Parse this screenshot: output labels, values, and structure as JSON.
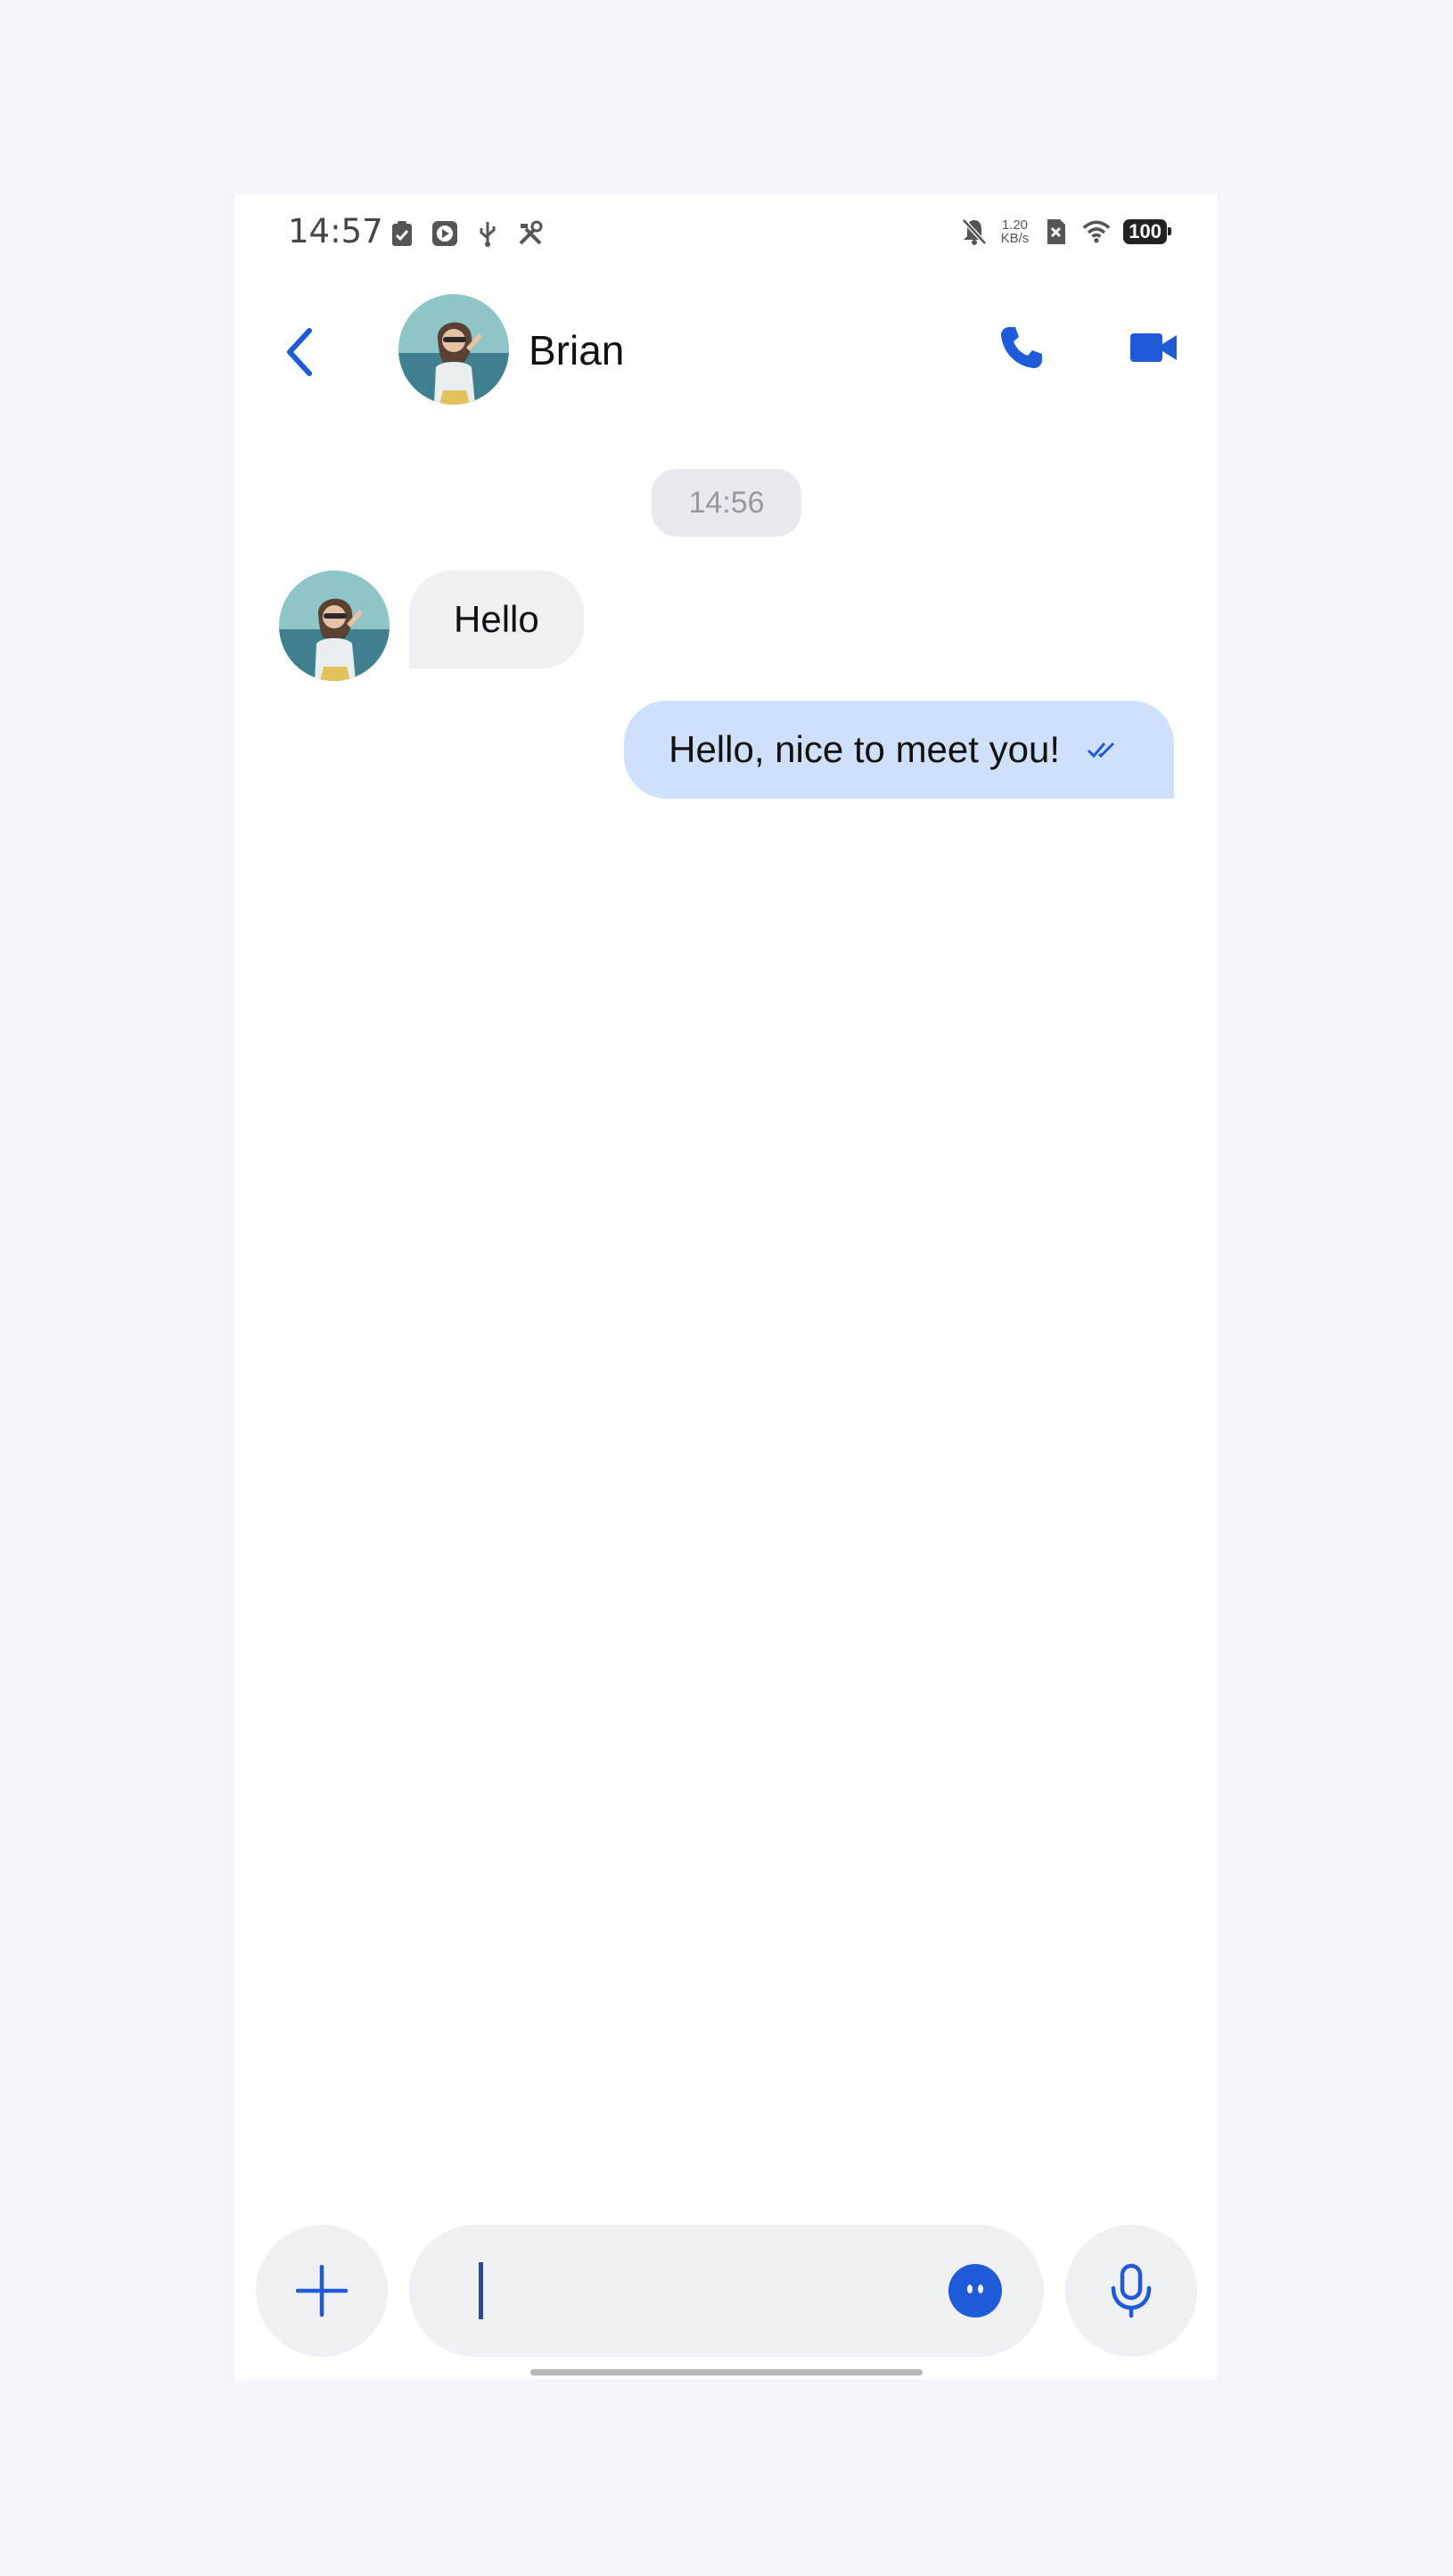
{
  "status_bar": {
    "time": "14:57",
    "net_speed_value": "1.20",
    "net_speed_unit": "KB/s",
    "battery": "100",
    "left_icons": [
      "clipboard-check-icon",
      "play-box-icon",
      "usb-icon",
      "tools-icon"
    ],
    "right_icons": [
      "bell-off-icon",
      "sim-x-icon",
      "wifi-icon"
    ]
  },
  "header": {
    "contact_name": "Brian",
    "back_icon": "chevron-left-icon",
    "call_icon": "phone-icon",
    "video_icon": "video-camera-icon"
  },
  "conversation": {
    "timestamp": "14:56",
    "messages": [
      {
        "direction": "incoming",
        "text": "Hello"
      },
      {
        "direction": "outgoing",
        "text": "Hello, nice to meet you!",
        "status": "read"
      }
    ]
  },
  "composer": {
    "value": "",
    "placeholder": "",
    "add_icon": "plus-icon",
    "emoji_icon": "emoji-icon",
    "mic_icon": "microphone-icon"
  },
  "colors": {
    "accent": "#1f5bd8",
    "outgoing_bubble": "#cfe0fb",
    "incoming_bubble": "#eef0f4",
    "background": "#f4f5fa"
  }
}
